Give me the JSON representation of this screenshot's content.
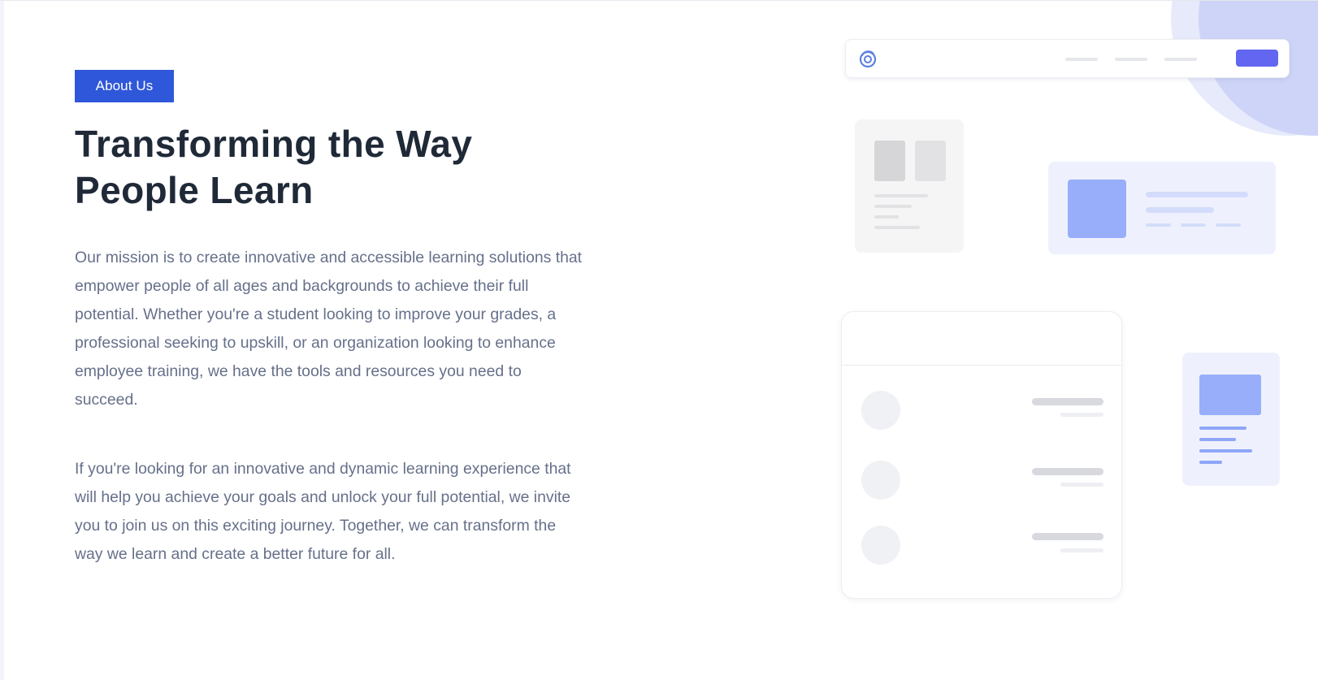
{
  "badge": {
    "label": "About Us",
    "color": "#2f57d9"
  },
  "headline": {
    "line1": "Transforming the Way",
    "line2": "People Learn"
  },
  "paragraphs": [
    "Our mission is to create innovative and accessible learning solutions that empower people of all ages and backgrounds to achieve their full potential. Whether you're a student looking to improve your grades, a professional seeking to upskill, or an organization looking to enhance employee training, we have the tools and resources you need to succeed.",
    "If you're looking for an innovative and dynamic learning experience that will help you achieve your goals and unlock your full potential, we invite you to join us on this exciting journey. Together, we can transform the way we learn and create a better future for all."
  ],
  "illustration": {
    "logo_icon": "swirl-logo-icon",
    "accent_color": "#6366f1",
    "block_color": "#98aefb",
    "list_rows": 3
  }
}
